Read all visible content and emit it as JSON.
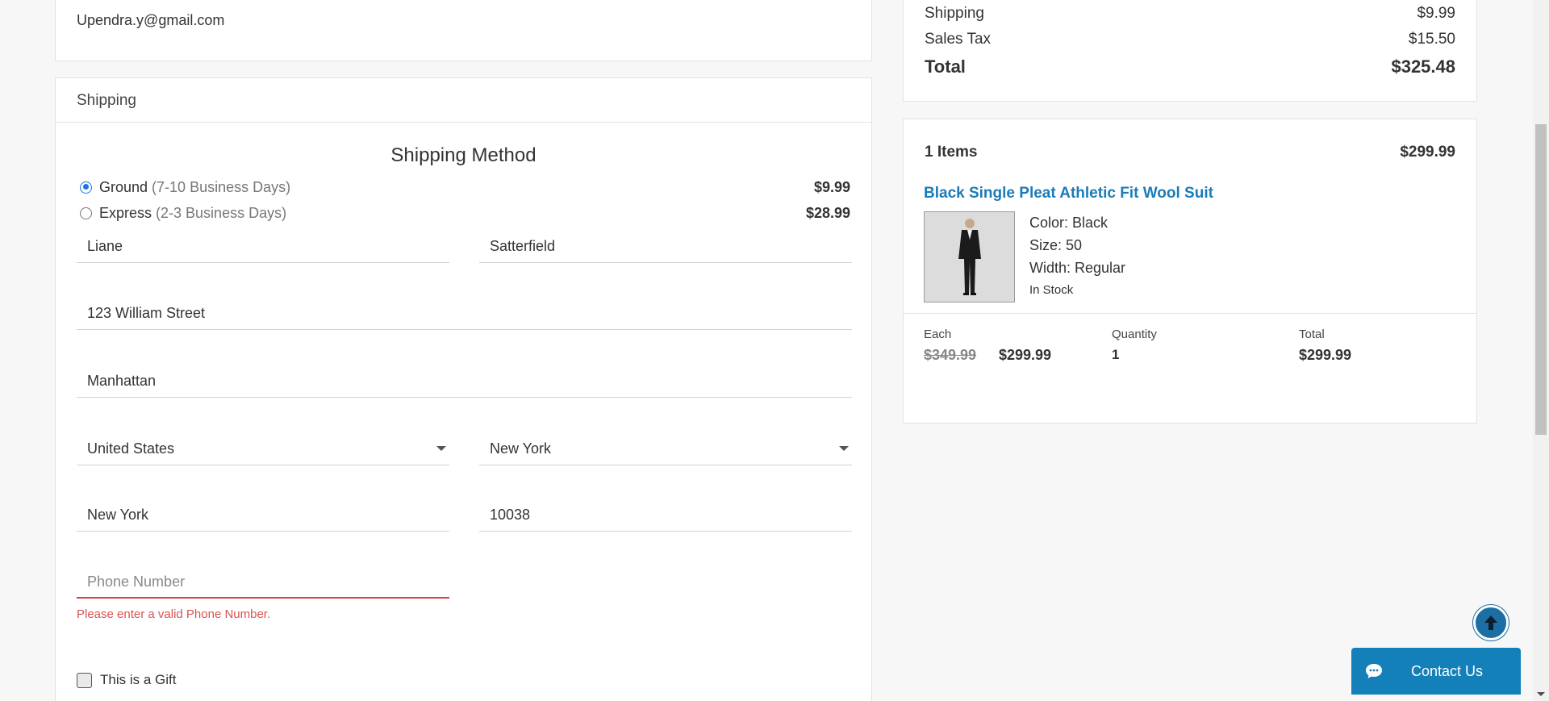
{
  "contact": {
    "email": "Upendra.y@gmail.com"
  },
  "shipping": {
    "header": "Shipping",
    "method_title": "Shipping Method",
    "methods": [
      {
        "name": "Ground",
        "detail": "(7-10 Business Days)",
        "price": "$9.99",
        "selected": true
      },
      {
        "name": "Express",
        "detail": "(2-3 Business Days)",
        "price": "$28.99",
        "selected": false
      }
    ],
    "first_name": "Liane",
    "last_name": "Satterfield",
    "address": "123 William Street",
    "address2": "Manhattan",
    "country": "United States",
    "state": "New York",
    "city": "New York",
    "zip": "10038",
    "phone_placeholder": "Phone Number",
    "phone_error": "Please enter a valid Phone Number.",
    "gift_label": "This is a Gift"
  },
  "summary": {
    "shipping_label": "Shipping",
    "shipping_value": "$9.99",
    "tax_label": "Sales Tax",
    "tax_value": "$15.50",
    "total_label": "Total",
    "total_value": "$325.48"
  },
  "cart": {
    "count_label": "1 Items",
    "subtotal": "$299.99",
    "item": {
      "name": "Black Single Pleat Athletic Fit Wool Suit",
      "color": "Color: Black",
      "size": "Size: 50",
      "width": "Width: Regular",
      "stock": "In Stock",
      "each_label": "Each",
      "original_price": "$349.99",
      "sale_price": "$299.99",
      "qty_label": "Quantity",
      "qty": "1",
      "total_label": "Total",
      "total": "$299.99"
    }
  },
  "contact_button": "Contact Us",
  "colors": {
    "link": "#1b7bb8",
    "accent": "#1480b9",
    "error": "#e03e3e"
  },
  "icons": {
    "scroll_top": "arrow-up-icon",
    "chat": "chat-bubble-icon"
  }
}
